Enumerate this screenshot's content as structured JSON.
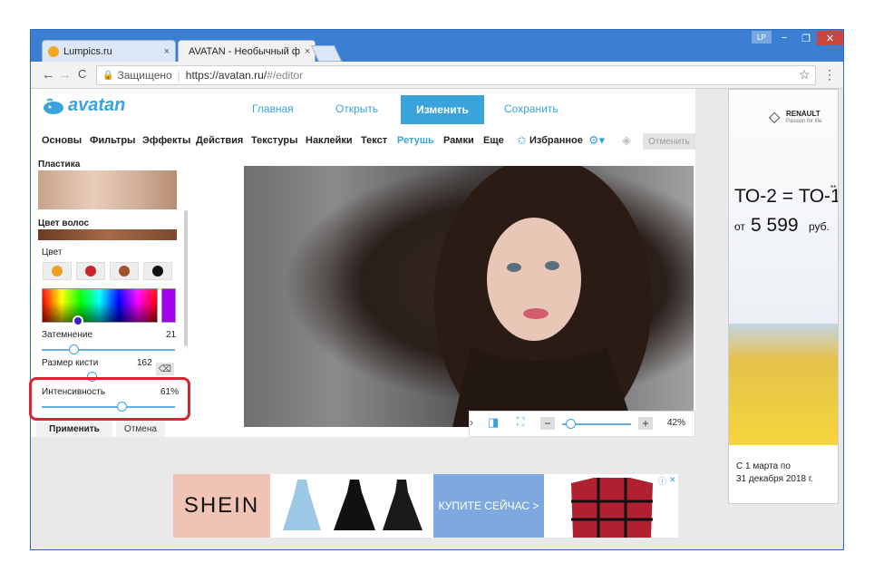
{
  "browser": {
    "tabs": [
      {
        "title": "Lumpics.ru",
        "close": "×"
      },
      {
        "title": "AVATAN - Необычный ф",
        "close": "×"
      }
    ],
    "profile_badge": "LP",
    "window_controls": {
      "minimize": "−",
      "restore": "❐",
      "close": "✕"
    },
    "nav": {
      "back": "←",
      "forward": "→",
      "reload": "C"
    },
    "omnibox": {
      "secure_label": "Защищено",
      "url_host": "https://avatan.ru/",
      "url_path": "#/editor"
    },
    "bookmark_icon": "star-icon",
    "menu_icon": "more-vert-icon"
  },
  "app": {
    "logo_text": "avatan",
    "top_nav": [
      {
        "label": "Главная"
      },
      {
        "label": "Открыть"
      },
      {
        "label": "Изменить"
      },
      {
        "label": "Сохранить"
      }
    ],
    "menu": [
      {
        "label": "Основы"
      },
      {
        "label": "Фильтры"
      },
      {
        "label": "Эффекты"
      },
      {
        "label": "Действия"
      },
      {
        "label": "Текстуры"
      },
      {
        "label": "Наклейки"
      },
      {
        "label": "Текст"
      },
      {
        "label": "Ретушь",
        "active": true
      },
      {
        "label": "Рамки"
      },
      {
        "label": "Еще"
      },
      {
        "label": "Избранное"
      }
    ],
    "cancel_top": "Отменить",
    "panel": {
      "section1": "Пластика",
      "section2": "Цвет волос",
      "color_label": "Цвет",
      "swatch_colors": [
        "#f0a020",
        "#c82828",
        "#a0522d",
        "#111111"
      ],
      "selected_color": "#a000f0",
      "sliders": [
        {
          "label": "Затемнение",
          "value": "21",
          "level": 0.21
        },
        {
          "label": "Размер кисти",
          "value": "162",
          "level": 0.4
        },
        {
          "label": "Интенсивность",
          "value": "61%",
          "level": 0.61
        }
      ],
      "apply_label": "Применить",
      "cancel_label": "Отмена"
    },
    "zoom": {
      "minus": "−",
      "plus": "+",
      "percent": "42%",
      "level": 0.05
    }
  },
  "ads": {
    "right": {
      "brand": "RENAULT",
      "tagline": "Passion for life",
      "headline": "ТО-2 = ТО-1",
      "asterisk": "**",
      "price_prefix": "от",
      "price": "5 599",
      "price_suffix": "руб.",
      "period_line1": "С 1 марта по",
      "period_line2": "31 декабря 2018 г."
    },
    "bottom": {
      "brand": "SHEIN",
      "cta": "КУПИТЕ СЕЙЧАС >",
      "info": "ⓘ",
      "close": "✕"
    }
  }
}
